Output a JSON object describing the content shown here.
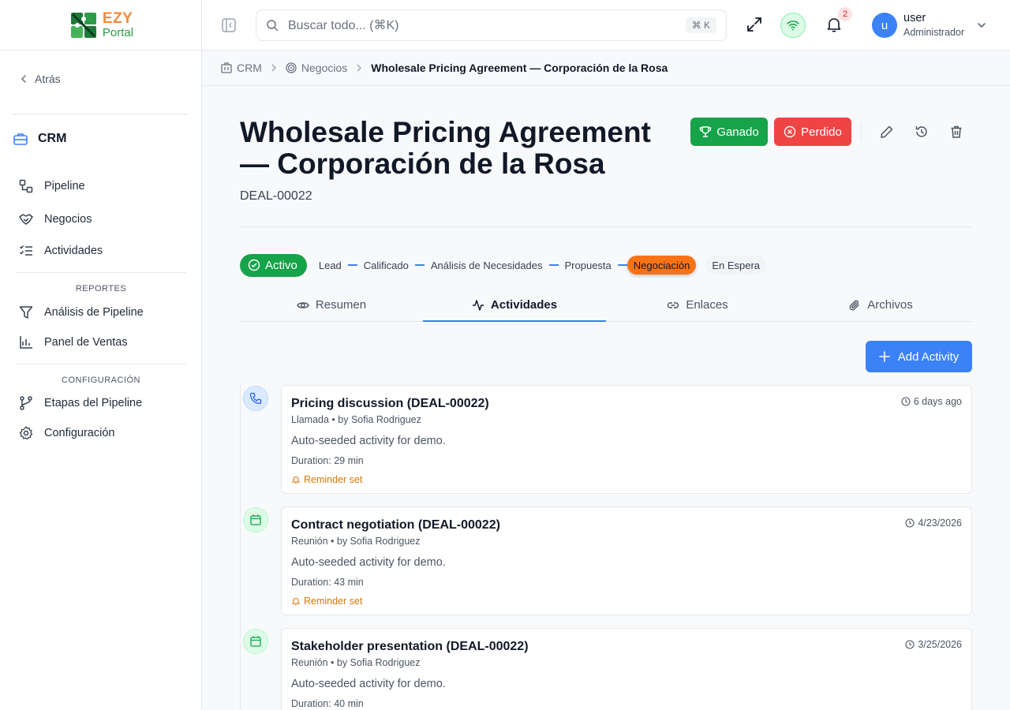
{
  "app": {
    "logo_top": "EZY",
    "logo_bottom": "Portal"
  },
  "sidebar": {
    "back_label": "Atrás",
    "module_label": "CRM",
    "items": [
      {
        "label": "Pipeline",
        "icon": "pipeline-icon"
      },
      {
        "label": "Negocios",
        "icon": "handshake-icon"
      },
      {
        "label": "Actividades",
        "icon": "checklist-icon"
      }
    ],
    "reports_header": "REPORTES",
    "reports": [
      {
        "label": "Análisis de Pipeline",
        "icon": "funnel-icon"
      },
      {
        "label": "Panel de Ventas",
        "icon": "bar-chart-icon"
      }
    ],
    "config_header": "CONFIGURACIÓN",
    "config": [
      {
        "label": "Etapas del Pipeline",
        "icon": "git-branch-icon"
      },
      {
        "label": "Configuración",
        "icon": "gear-icon"
      }
    ]
  },
  "header": {
    "search_placeholder": "Buscar todo... (⌘K)",
    "search_kbd": "⌘ K",
    "notifications_count": "2",
    "user_initial": "u",
    "user_name": "user",
    "user_role": "Administrador"
  },
  "breadcrumb": {
    "items": [
      "CRM",
      "Negocios"
    ],
    "current": "Wholesale Pricing Agreement — Corporación de la Rosa"
  },
  "deal": {
    "title": "Wholesale Pricing Agreement — Corporación de la Rosa",
    "id": "DEAL-00022",
    "won_label": "Ganado",
    "lost_label": "Perdido",
    "status": "Activo",
    "stages": [
      "Lead",
      "Calificado",
      "Análisis de Necesidades",
      "Propuesta",
      "Negociación"
    ],
    "active_stage": "Negociación",
    "hold_stage": "En Espera"
  },
  "tabs": [
    {
      "label": "Resumen",
      "active": false
    },
    {
      "label": "Actividades",
      "active": true
    },
    {
      "label": "Enlaces",
      "active": false
    },
    {
      "label": "Archivos",
      "active": false
    }
  ],
  "add_activity_label": "Add Activity",
  "activities": [
    {
      "title": "Pricing discussion (DEAL-00022)",
      "subtitle": "Llamada • by Sofia Rodriguez",
      "description": "Auto-seeded activity for demo.",
      "duration": "Duration: 29 min",
      "reminder": "Reminder set",
      "date": "6 days ago",
      "icon": "phone-icon"
    },
    {
      "title": "Contract negotiation (DEAL-00022)",
      "subtitle": "Reunión • by Sofia Rodriguez",
      "description": "Auto-seeded activity for demo.",
      "duration": "Duration: 43 min",
      "reminder": "Reminder set",
      "date": "4/23/2026",
      "icon": "calendar-icon"
    },
    {
      "title": "Stakeholder presentation (DEAL-00022)",
      "subtitle": "Reunión • by Sofia Rodriguez",
      "description": "Auto-seeded activity for demo.",
      "duration": "Duration: 40 min",
      "date": "3/25/2026",
      "icon": "calendar-icon"
    }
  ],
  "colors": {
    "accent": "#3b82f6",
    "won": "#16a34a",
    "lost": "#ef4444",
    "active_stage": "#f97316"
  }
}
